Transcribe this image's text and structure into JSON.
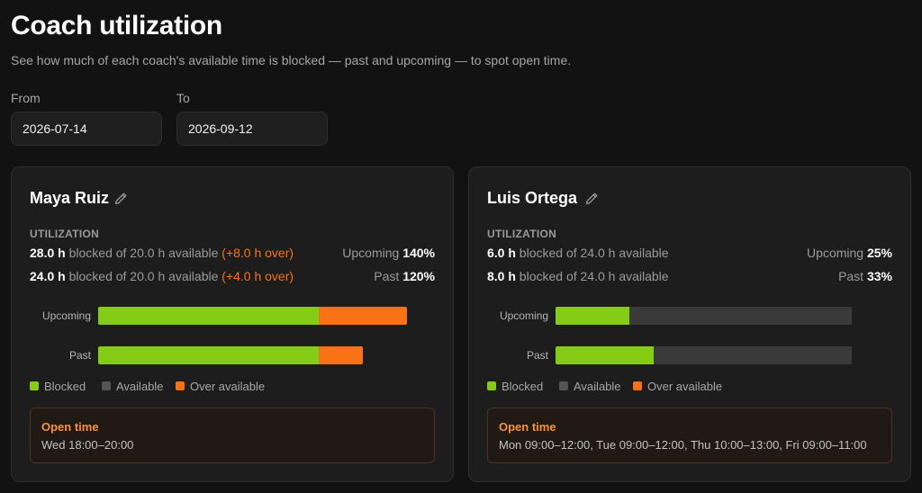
{
  "page": {
    "title": "Coach utilization",
    "subtitle": "See how much of each coach's available time is blocked — past and upcoming — to spot open time."
  },
  "filters": {
    "from_label": "From",
    "from_value": "2026-07-14",
    "to_label": "To",
    "to_value": "2026-09-12"
  },
  "colors": {
    "blocked": "#84cc16",
    "available": "#555555",
    "over_available": "#f97316",
    "open_time_accent": "#fb923c"
  },
  "coaches": [
    {
      "name": "Maya Ruiz",
      "edit_icon": "pencil-icon",
      "utilization_label": "UTILIZATION",
      "upcoming": {
        "blocked": "28.0 h",
        "mid": "blocked of 20.0 h available",
        "over": "(+8.0 h over)",
        "label": "Upcoming",
        "percent": "140%",
        "bar_label": "Upcoming",
        "fraction": 1.4
      },
      "past": {
        "blocked": "24.0 h",
        "mid": "blocked of 20.0 h available",
        "over": "(+4.0 h over)",
        "label": "Past",
        "percent": "120%",
        "bar_label": "Past",
        "fraction": 1.2
      },
      "legend": {
        "blocked": "Blocked",
        "available": "Available",
        "over": "Over available"
      },
      "open_time": {
        "title": "Open time",
        "slots": "Wed 18:00–20:00"
      }
    },
    {
      "name": "Luis Ortega",
      "edit_icon": "pencil-icon",
      "utilization_label": "UTILIZATION",
      "upcoming": {
        "blocked": "6.0 h",
        "mid": "blocked of 24.0 h available",
        "over": "",
        "label": "Upcoming",
        "percent": "25%",
        "bar_label": "Upcoming",
        "fraction": 0.25
      },
      "past": {
        "blocked": "8.0 h",
        "mid": "blocked of 24.0 h available",
        "over": "",
        "label": "Past",
        "percent": "33%",
        "bar_label": "Past",
        "fraction": 0.33
      },
      "legend": {
        "blocked": "Blocked",
        "available": "Available",
        "over": "Over available"
      },
      "open_time": {
        "title": "Open time",
        "slots": "Mon 09:00–12:00, Tue 09:00–12:00, Thu 10:00–13:00, Fri 09:00–11:00"
      }
    }
  ]
}
